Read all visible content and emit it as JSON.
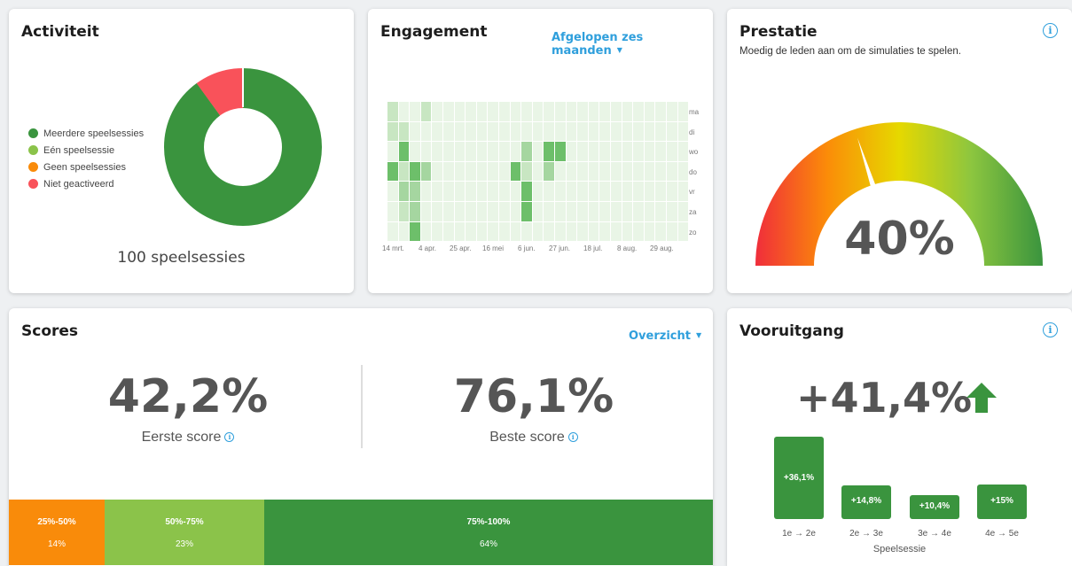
{
  "activity": {
    "title": "Activiteit",
    "legend": [
      {
        "label": "Meerdere speelsessies",
        "color": "#3a943e"
      },
      {
        "label": "Eén speelsessie",
        "color": "#8bc34a"
      },
      {
        "label": "Geen speelsessies",
        "color": "#f98b0a"
      },
      {
        "label": "Niet geactiveerd",
        "color": "#f9525a"
      }
    ],
    "donut_share": {
      "multi": 0.9,
      "not_activated": 0.1
    },
    "total_label": "100 speelsessies"
  },
  "engagement": {
    "title": "Engagement",
    "period_dropdown": "Afgelopen zes maanden",
    "days": [
      "ma",
      "di",
      "wo",
      "do",
      "vr",
      "za",
      "zo"
    ],
    "months": [
      "14 mrt.",
      "4 apr.",
      "25 apr.",
      "16 mei",
      "6 jun.",
      "27 jun.",
      "18 jul.",
      "8 aug.",
      "29 aug."
    ],
    "base_color": "#e9f5e6",
    "levels": {
      "1": "#c8e6c2",
      "2": "#a5d6a0",
      "3": "#6dbf6a"
    },
    "active_cells": [
      {
        "c": 0,
        "d": 0,
        "l": 1
      },
      {
        "c": 3,
        "d": 0,
        "l": 1
      },
      {
        "c": 0,
        "d": 1,
        "l": 1
      },
      {
        "c": 1,
        "d": 1,
        "l": 1
      },
      {
        "c": 1,
        "d": 2,
        "l": 3
      },
      {
        "c": 12,
        "d": 2,
        "l": 2
      },
      {
        "c": 14,
        "d": 2,
        "l": 3
      },
      {
        "c": 15,
        "d": 2,
        "l": 3
      },
      {
        "c": 0,
        "d": 3,
        "l": 3
      },
      {
        "c": 1,
        "d": 3,
        "l": 1
      },
      {
        "c": 2,
        "d": 3,
        "l": 3
      },
      {
        "c": 3,
        "d": 3,
        "l": 2
      },
      {
        "c": 11,
        "d": 3,
        "l": 3
      },
      {
        "c": 12,
        "d": 3,
        "l": 1
      },
      {
        "c": 14,
        "d": 3,
        "l": 2
      },
      {
        "c": 1,
        "d": 4,
        "l": 2
      },
      {
        "c": 2,
        "d": 4,
        "l": 2
      },
      {
        "c": 12,
        "d": 4,
        "l": 3
      },
      {
        "c": 1,
        "d": 5,
        "l": 1
      },
      {
        "c": 2,
        "d": 5,
        "l": 2
      },
      {
        "c": 12,
        "d": 5,
        "l": 3
      },
      {
        "c": 2,
        "d": 6,
        "l": 3
      }
    ]
  },
  "performance": {
    "title": "Prestatie",
    "subtitle": "Moedig de leden aan om de simulaties te spelen.",
    "value": 0.4,
    "value_label": "40%"
  },
  "scores": {
    "title": "Scores",
    "view_dropdown": "Overzicht",
    "first": {
      "value": "42,2%",
      "label": "Eerste score"
    },
    "best": {
      "value": "76,1%",
      "label": "Beste score"
    },
    "bands": [
      {
        "range": "25%-50%",
        "pct": "14%",
        "color": "#f98b0a"
      },
      {
        "range": "50%-75%",
        "pct": "23%",
        "color": "#8bc34a"
      },
      {
        "range": "75%-100%",
        "pct": "64%",
        "color": "#3a943e"
      }
    ]
  },
  "progress": {
    "title": "Vooruitgang",
    "value": "+41,4%",
    "bars": [
      {
        "label": "+36,1%",
        "x": "1e → 2e",
        "v": 36.1
      },
      {
        "label": "+14,8%",
        "x": "2e → 3e",
        "v": 14.8
      },
      {
        "label": "+10,4%",
        "x": "3e → 4e",
        "v": 10.4
      },
      {
        "label": "+15%",
        "x": "4e → 5e",
        "v": 15
      }
    ],
    "axis_label": "Speelsessie"
  }
}
